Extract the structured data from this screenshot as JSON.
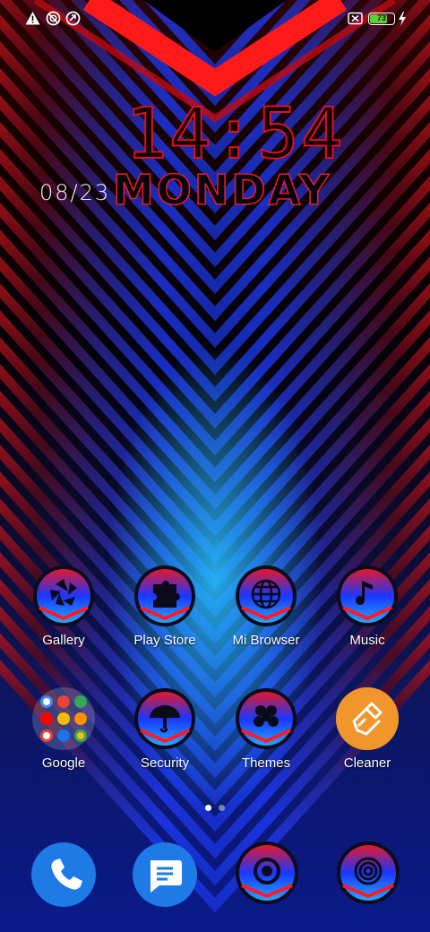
{
  "status_bar": {
    "left_icons": [
      "warning-icon",
      "do-not-disturb-icon",
      "data-saver-icon"
    ],
    "right_icons": [
      "sim-off-icon",
      "battery-icon",
      "charging-icon"
    ],
    "battery_level": "73"
  },
  "clock_widget": {
    "time": "14:54",
    "date": "08/23",
    "day": "MONDAY"
  },
  "home_apps": [
    {
      "label": "Gallery",
      "icon": "gallery-icon"
    },
    {
      "label": "Play Store",
      "icon": "play-store-icon"
    },
    {
      "label": "Mi Browser",
      "icon": "globe-icon"
    },
    {
      "label": "Music",
      "icon": "music-note-icon"
    },
    {
      "label": "Google",
      "icon": "google-folder-icon"
    },
    {
      "label": "Security",
      "icon": "security-icon"
    },
    {
      "label": "Themes",
      "icon": "themes-icon"
    },
    {
      "label": "Cleaner",
      "icon": "cleaner-brush-icon"
    }
  ],
  "pager": {
    "pages": 2,
    "current": 1
  },
  "dock": [
    {
      "name": "phone",
      "icon": "phone-icon"
    },
    {
      "name": "messages",
      "icon": "messages-icon"
    },
    {
      "name": "camera",
      "icon": "camera-icon"
    },
    {
      "name": "settings",
      "icon": "settings-icon"
    }
  ],
  "colors": {
    "accent_red": "#e0101c",
    "accent_blue": "#1a4dff",
    "cleaner_orange": "#f0962a",
    "dock_blue": "#1e7be6",
    "battery_green": "#5cd134"
  }
}
